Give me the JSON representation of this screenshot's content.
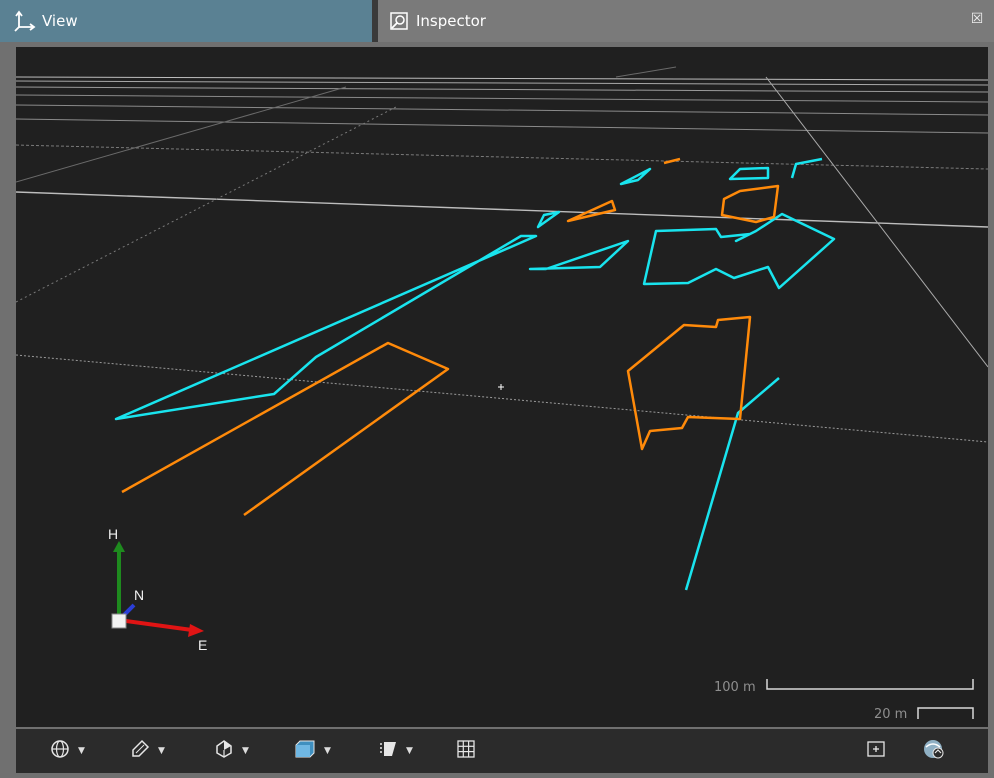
{
  "tabs": [
    {
      "label": "View",
      "icon": "axes-icon",
      "active": true
    },
    {
      "label": "Inspector",
      "icon": "inspector-icon",
      "active": false
    }
  ],
  "close_glyph": "☒",
  "compass": {
    "up_label": "H",
    "north_label": "N",
    "east_label": "E"
  },
  "scale": {
    "large_label": "100 m",
    "small_label": "20 m"
  },
  "toolbar": {
    "buttons": [
      {
        "name": "globe-icon",
        "has_dropdown": true
      },
      {
        "name": "measure-tool-icon",
        "has_dropdown": true
      },
      {
        "name": "shading-icon",
        "has_dropdown": true
      },
      {
        "name": "box-icon",
        "has_dropdown": true
      },
      {
        "name": "filter-icon",
        "has_dropdown": true
      },
      {
        "name": "grid-icon",
        "has_dropdown": false
      },
      {
        "name": "zoom-extent-icon",
        "has_dropdown": false
      },
      {
        "name": "camera-sync-icon",
        "has_dropdown": false
      }
    ]
  },
  "colors": {
    "tab_active_bg": "#5a8193",
    "viewport_bg": "#202020",
    "cyan_lines": "#19e4ee",
    "orange_lines": "#ff8a0a",
    "axis_up": "#1e8a1e",
    "axis_north": "#2a3ed8",
    "axis_east": "#e01414"
  }
}
